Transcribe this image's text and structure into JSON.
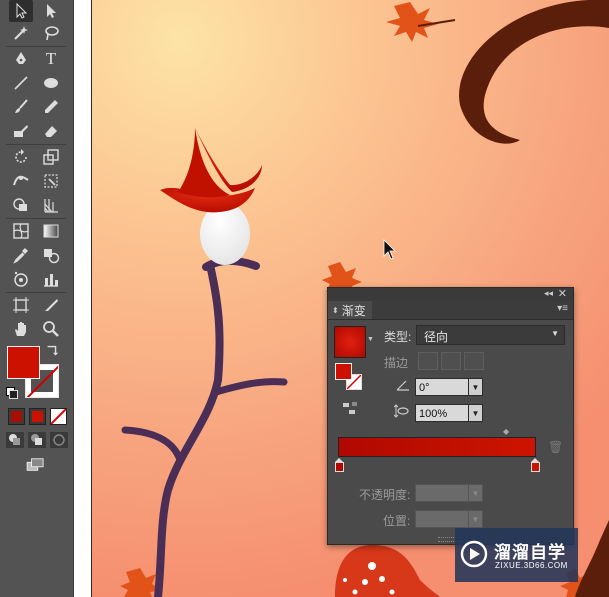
{
  "toolbar": {
    "tools": [
      {
        "name": "selection-tool",
        "icon": "arrow-icon",
        "active": true
      },
      {
        "name": "direct-selection-tool",
        "icon": "white-arrow-icon"
      },
      {
        "name": "magic-wand-tool",
        "icon": "magic-wand-icon"
      },
      {
        "name": "lasso-tool",
        "icon": "lasso-icon"
      },
      {
        "name": "pen-tool",
        "icon": "pen-icon"
      },
      {
        "name": "type-tool",
        "icon": "type-icon",
        "glyph": "T"
      },
      {
        "name": "line-tool",
        "icon": "line-icon"
      },
      {
        "name": "ellipse-tool",
        "icon": "ellipse-icon"
      },
      {
        "name": "paintbrush-tool",
        "icon": "brush-icon"
      },
      {
        "name": "pencil-tool",
        "icon": "pencil-icon"
      },
      {
        "name": "blob-brush-tool",
        "icon": "blob-brush-icon"
      },
      {
        "name": "eraser-tool",
        "icon": "eraser-icon"
      },
      {
        "name": "rotate-tool",
        "icon": "rotate-icon"
      },
      {
        "name": "scale-tool",
        "icon": "scale-icon"
      },
      {
        "name": "width-tool",
        "icon": "width-icon"
      },
      {
        "name": "free-transform-tool",
        "icon": "free-transform-icon"
      },
      {
        "name": "shape-builder-tool",
        "icon": "shape-builder-icon"
      },
      {
        "name": "perspective-grid-tool",
        "icon": "perspective-icon"
      },
      {
        "name": "mesh-tool",
        "icon": "mesh-icon"
      },
      {
        "name": "gradient-tool",
        "icon": "gradient-icon"
      },
      {
        "name": "eyedropper-tool",
        "icon": "eyedropper-icon"
      },
      {
        "name": "blend-tool",
        "icon": "blend-icon"
      },
      {
        "name": "symbol-sprayer-tool",
        "icon": "symbol-sprayer-icon"
      },
      {
        "name": "column-graph-tool",
        "icon": "graph-icon"
      },
      {
        "name": "artboard-tool",
        "icon": "artboard-icon"
      },
      {
        "name": "slice-tool",
        "icon": "slice-icon"
      },
      {
        "name": "hand-tool",
        "icon": "hand-icon"
      },
      {
        "name": "zoom-tool",
        "icon": "zoom-icon"
      }
    ],
    "fill_color": "#cc1100",
    "stroke_color": "#cc1100"
  },
  "gradient_panel": {
    "tab_label": "渐变",
    "type_label": "类型:",
    "type_value": "径向",
    "stroke_label": "描边",
    "angle_value": "0°",
    "aspect_value": "100%",
    "opacity_label": "不透明度:",
    "location_label": "位置:",
    "gradient_start": "#b00800",
    "gradient_end": "#cc1500"
  },
  "watermark": {
    "title": "溜溜自学",
    "url": "ZIXUE.3D66.COM"
  }
}
